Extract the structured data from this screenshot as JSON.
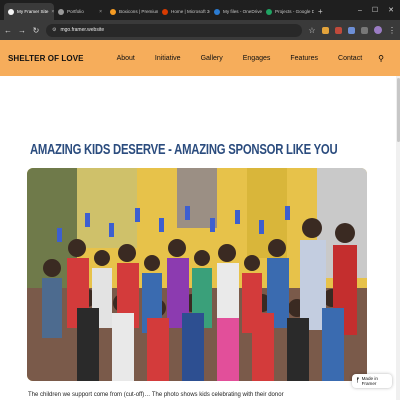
{
  "browser": {
    "tabs": [
      {
        "label": "My Framer Site",
        "color": "#f5f5f5",
        "active": true
      },
      {
        "label": "Portfolio",
        "color": "#999999",
        "active": false
      },
      {
        "label": "Boxicons | Premium web",
        "color": "#f59b23",
        "active": false
      },
      {
        "label": "Home | Microsoft 365",
        "color": "#d83b01",
        "active": false
      },
      {
        "label": "My files - OneDrive",
        "color": "#2b7cd3",
        "active": false
      },
      {
        "label": "Projects - Google Drive",
        "color": "#1fa463",
        "active": false
      }
    ],
    "url": "mgo.framer.website"
  },
  "site": {
    "logo": "SHELTER OF LOVE",
    "menu": [
      "About",
      "Initiative",
      "Gallery",
      "Engages",
      "Features",
      "Contact"
    ],
    "heading": "AMAZING KIDS DESERVE - AMAZING SPONSOR LIKE YOU",
    "body_text": "The children we support come from (cut-off)…  The photo shows kids celebrating with their donor",
    "badge": "Made in Framer"
  },
  "colors": {
    "header_bg": "#f6ad5b",
    "heading": "#2b4c7e"
  }
}
